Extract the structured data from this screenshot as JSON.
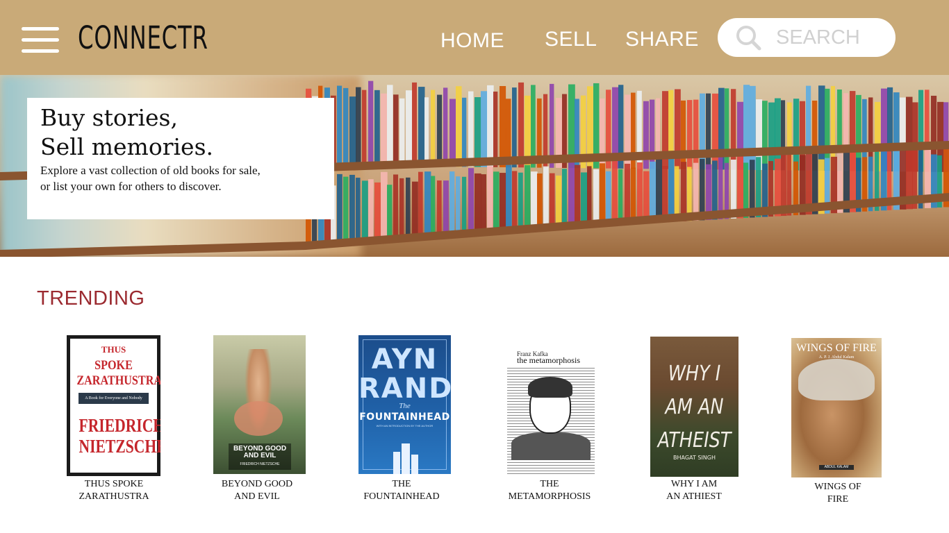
{
  "header": {
    "brand": "CONNECTR",
    "nav": {
      "home": "HOME",
      "sell": "SELL",
      "share": "SHARE"
    },
    "search_placeholder": "SEARCH"
  },
  "hero": {
    "title": "Buy stories,\nSell memories.",
    "subtitle": "Explore a vast collection of old books for sale,\nor list your own for others to discover."
  },
  "trending": {
    "heading": "TRENDING",
    "books": [
      {
        "label": "THUS SPOKE\nZARATHUSTRA",
        "cover": {
          "top": "THUS",
          "title": "SPOKE\nZARATHUSTRA",
          "tagline": "A Book for Everyone and Nobody",
          "author": "FRIEDRICH\nNIETZSCHE"
        }
      },
      {
        "label": "BEYOND GOOD\nAND EVIL",
        "cover": {
          "title": "BEYOND GOOD\nAND EVIL",
          "author": "FRIEDRICH NIETZSCHE"
        }
      },
      {
        "label": "THE\nFOUNTAINHEAD",
        "cover": {
          "author": "AYN\nRAND",
          "title": "FOUNTAINHEAD",
          "the": "The",
          "tagline": "WITH AN INTRODUCTION BY THE AUTHOR"
        }
      },
      {
        "label": "THE\nMETAMORPHOSIS",
        "cover": {
          "author": "Franz Kafka",
          "title": "the metamorphosis"
        }
      },
      {
        "label": "WHY I AM\nAN ATHIEST",
        "cover": {
          "title": "WHY I\nAM AN\nATHEIST",
          "author": "BHAGAT SINGH"
        }
      },
      {
        "label": "WINGS OF\nFIRE",
        "cover": {
          "title": "WINGS OF FIRE",
          "author": "A. P. J. Abdul Kalam",
          "author_badge": "ABDUL KALAM"
        }
      }
    ]
  },
  "colors": {
    "header_bg": "#c9aa78",
    "section_title": "#9b2a30",
    "nav_text": "#ffffff"
  }
}
